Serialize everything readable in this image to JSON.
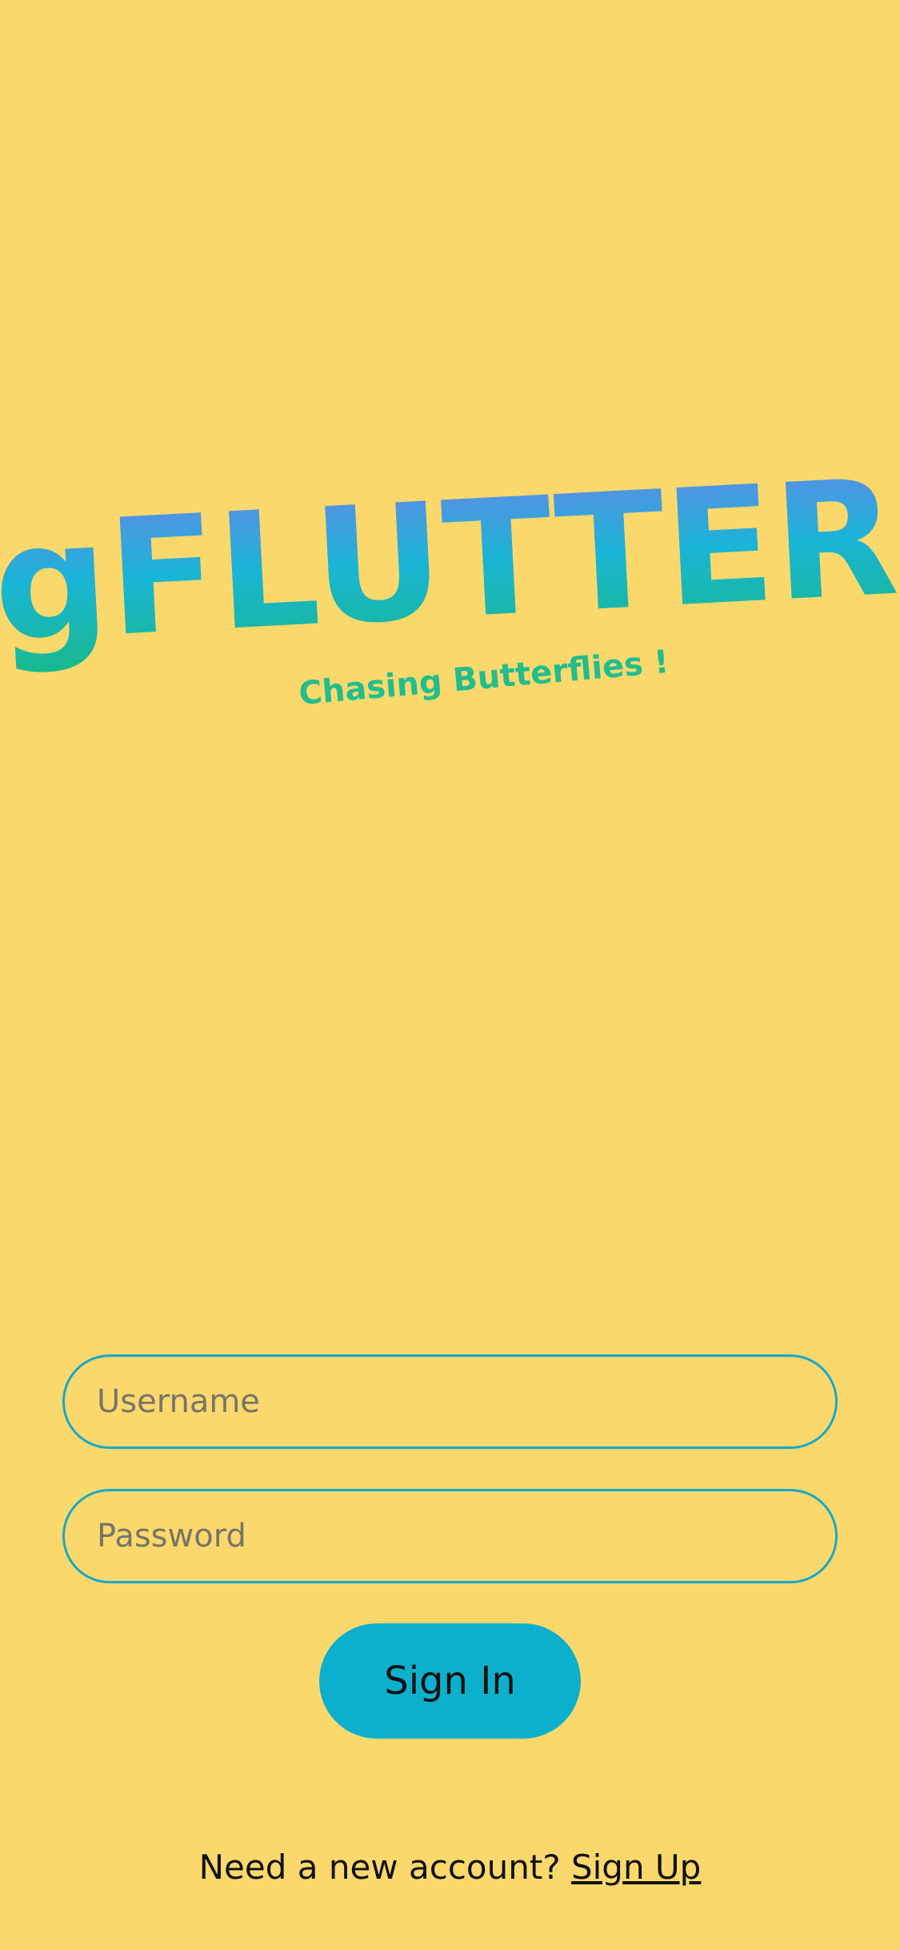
{
  "logo": {
    "wordmark": "gFLUTTER",
    "tagline": "Chasing Butterflies !",
    "gradient_top": "#6A86E8",
    "gradient_mid": "#19B5D6",
    "gradient_bottom": "#19B98A"
  },
  "form": {
    "username_placeholder": "Username",
    "password_placeholder": "Password",
    "signin_label": "Sign In"
  },
  "footer": {
    "prompt": "Need a new account?",
    "signup_label": "Sign Up"
  },
  "colors": {
    "background": "#FAD86C",
    "accent": "#0CB0CD",
    "field_border": "#18A8C9"
  }
}
